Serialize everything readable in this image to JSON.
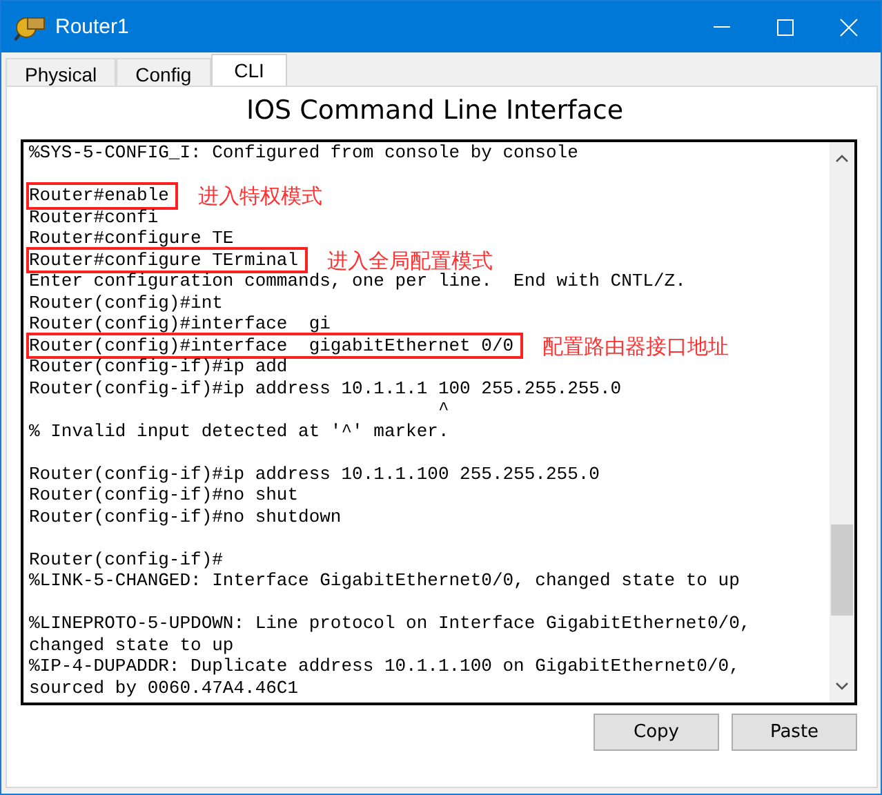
{
  "window": {
    "title": "Router1"
  },
  "tabs": [
    {
      "label": "Physical",
      "selected": false
    },
    {
      "label": "Config",
      "selected": false
    },
    {
      "label": "CLI",
      "selected": true
    }
  ],
  "heading": "IOS Command Line Interface",
  "terminal": {
    "lines": [
      {
        "kind": "text",
        "text": "%SYS-5-CONFIG_I: Configured from console by console"
      },
      {
        "kind": "blank"
      },
      {
        "kind": "text",
        "text": "Router#enable",
        "highlighted": true,
        "annotation": "进入特权模式"
      },
      {
        "kind": "text",
        "text": "Router#confi"
      },
      {
        "kind": "text",
        "text": "Router#configure TE"
      },
      {
        "kind": "text",
        "text": "Router#configure TErminal",
        "highlighted": true,
        "annotation": "进入全局配置模式"
      },
      {
        "kind": "text",
        "text": "Enter configuration commands, one per line.  End with CNTL/Z."
      },
      {
        "kind": "text",
        "text": "Router(config)#int"
      },
      {
        "kind": "text",
        "text": "Router(config)#interface  gi"
      },
      {
        "kind": "text",
        "text": "Router(config)#interface  gigabitEthernet 0/0",
        "highlighted": true,
        "annotation": "配置路由器接口地址"
      },
      {
        "kind": "text",
        "text": "Router(config-if)#ip add"
      },
      {
        "kind": "text",
        "text": "Router(config-if)#ip address 10.1.1.1 100 255.255.255.0"
      },
      {
        "kind": "text",
        "text": "                                      ^"
      },
      {
        "kind": "text",
        "text": "% Invalid input detected at '^' marker."
      },
      {
        "kind": "blank"
      },
      {
        "kind": "text",
        "text": "Router(config-if)#ip address 10.1.1.100 255.255.255.0"
      },
      {
        "kind": "text",
        "text": "Router(config-if)#no shut"
      },
      {
        "kind": "text",
        "text": "Router(config-if)#no shutdown"
      },
      {
        "kind": "blank"
      },
      {
        "kind": "text",
        "text": "Router(config-if)#"
      },
      {
        "kind": "text",
        "text": "%LINK-5-CHANGED: Interface GigabitEthernet0/0, changed state to up"
      },
      {
        "kind": "blank"
      },
      {
        "kind": "text",
        "text": "%LINEPROTO-5-UPDOWN: Line protocol on Interface GigabitEthernet0/0,"
      },
      {
        "kind": "text",
        "text": "changed state to up"
      },
      {
        "kind": "text",
        "text": "%IP-4-DUPADDR: Duplicate address 10.1.1.100 on GigabitEthernet0/0,"
      },
      {
        "kind": "text",
        "text": "sourced by 0060.47A4.46C1"
      }
    ]
  },
  "buttons": [
    "Copy",
    "Paste"
  ]
}
